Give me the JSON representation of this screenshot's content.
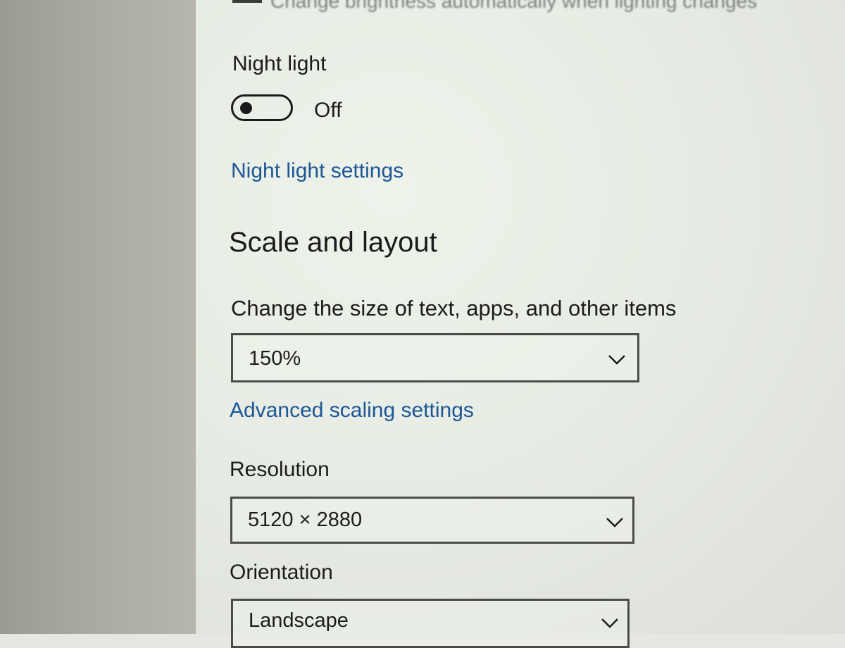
{
  "top_partial_text": "Change brightness automatically when lighting changes",
  "night_light": {
    "label": "Night light",
    "toggle_state": "Off",
    "settings_link": "Night light settings"
  },
  "scale_layout": {
    "heading": "Scale and layout",
    "size_label": "Change the size of text, apps, and other items",
    "size_value": "150%",
    "advanced_link": "Advanced scaling settings",
    "resolution_label": "Resolution",
    "resolution_value": "5120 × 2880",
    "orientation_label": "Orientation",
    "orientation_value": "Landscape"
  },
  "icons": {
    "toggle_knob": "toggle-knob-icon",
    "dropdown_arrow": "chevron-down-icon"
  },
  "colors": {
    "link": "#1d5796",
    "text": "#1c1c1c",
    "background": "#e6ebe3"
  }
}
